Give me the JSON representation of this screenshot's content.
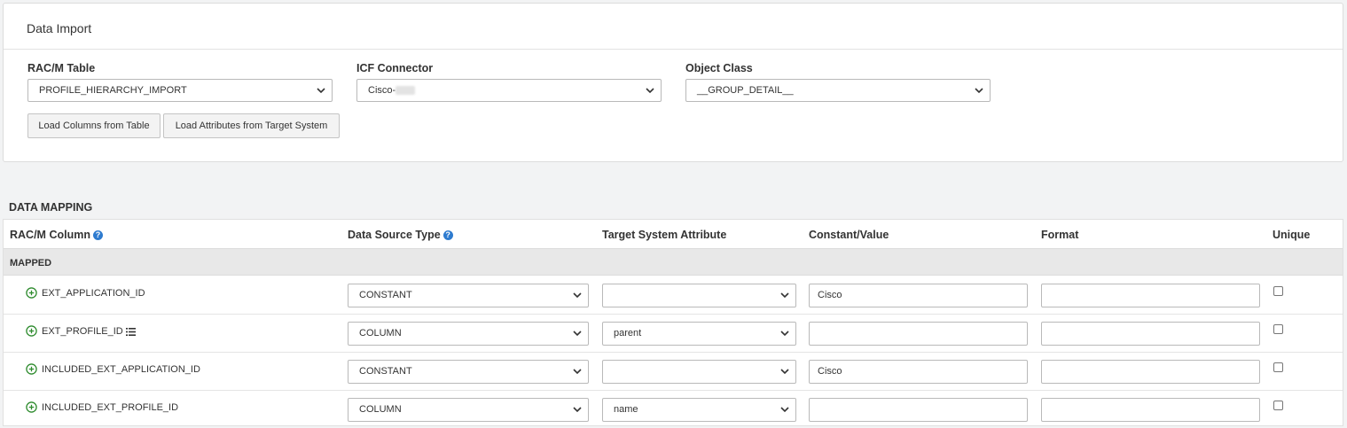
{
  "panel": {
    "title": "Data Import",
    "fields": [
      {
        "label": "RAC/M Table",
        "value": "PROFILE_HIERARCHY_IMPORT"
      },
      {
        "label": "ICF Connector",
        "value": "Cisco-"
      },
      {
        "label": "Object Class",
        "value": "__GROUP_DETAIL__"
      }
    ],
    "buttons": {
      "load_columns": "Load Columns from Table",
      "load_attributes": "Load Attributes from Target System"
    }
  },
  "mapping": {
    "heading": "DATA MAPPING",
    "columns": {
      "racm_column": "RAC/M Column",
      "data_source_type": "Data Source Type",
      "target_attribute": "Target System Attribute",
      "constant_value": "Constant/Value",
      "format": "Format",
      "unique": "Unique"
    },
    "group_label": "MAPPED",
    "rows": [
      {
        "column": "EXT_APPLICATION_ID",
        "has_list_icon": false,
        "source_type": "CONSTANT",
        "target_attribute": "",
        "constant": "Cisco",
        "format": "",
        "unique": false
      },
      {
        "column": "EXT_PROFILE_ID",
        "has_list_icon": true,
        "source_type": "COLUMN",
        "target_attribute": "parent",
        "constant": "",
        "format": "",
        "unique": false
      },
      {
        "column": "INCLUDED_EXT_APPLICATION_ID",
        "has_list_icon": false,
        "source_type": "CONSTANT",
        "target_attribute": "",
        "constant": "Cisco",
        "format": "",
        "unique": false
      },
      {
        "column": "INCLUDED_EXT_PROFILE_ID",
        "has_list_icon": false,
        "source_type": "COLUMN",
        "target_attribute": "name",
        "constant": "",
        "format": "",
        "unique": false
      }
    ]
  },
  "colors": {
    "page_background": "#f2f3f4",
    "help_icon": "#2e7bcf",
    "add_icon": "#2e8b2e",
    "group_row": "#e8e8e8"
  },
  "icons": [
    "chevron-down-icon",
    "help-icon",
    "add-circle-icon",
    "list-icon"
  ]
}
